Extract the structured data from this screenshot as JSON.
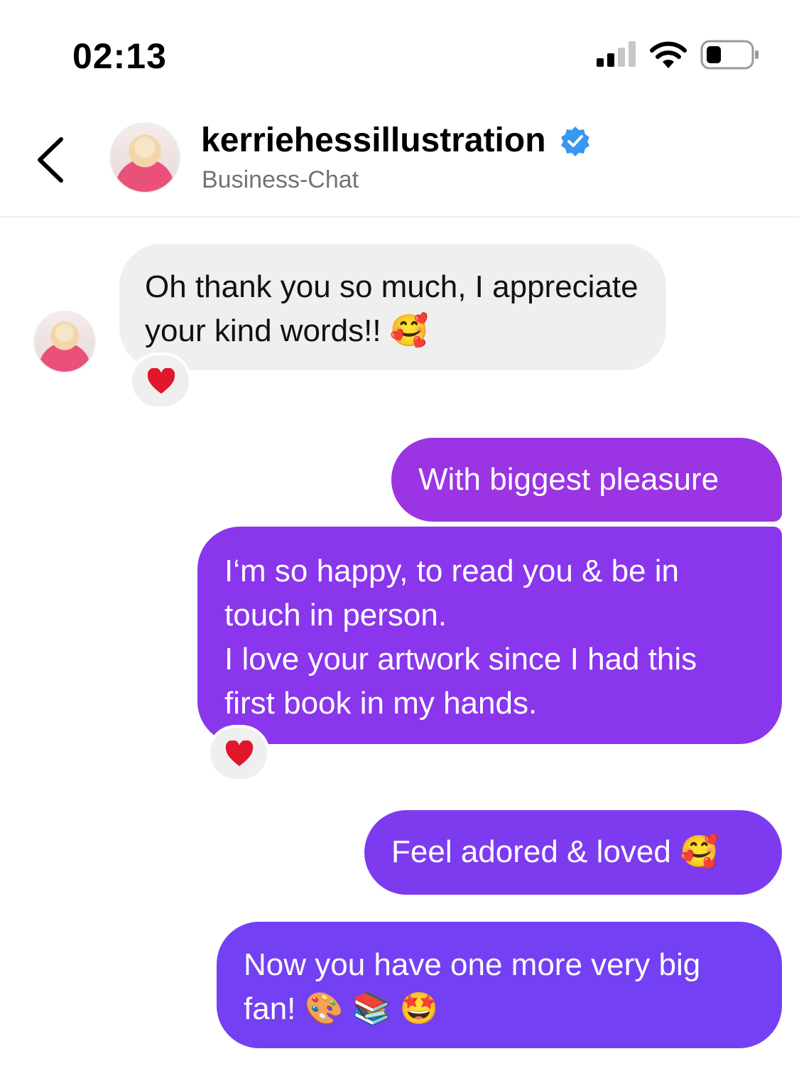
{
  "status_bar": {
    "time": "02:13"
  },
  "header": {
    "username": "kerriehessillustration",
    "subtitle": "Business-Chat"
  },
  "messages": [
    {
      "sender": "them",
      "text": "Oh thank you so much, I appreciate your kind words!! 🥰",
      "reaction": "❤️"
    },
    {
      "sender": "me",
      "text": "With biggest pleasure"
    },
    {
      "sender": "me",
      "text_line1": "I‘m so happy, to read you & be in touch in person.",
      "text_line2": "I love your artwork since I had this first book in my hands.",
      "reaction": "❤️"
    },
    {
      "sender": "me",
      "text": "Feel adored & loved 🥰"
    },
    {
      "sender": "me",
      "text": "Now you have one more very big fan! 🎨 📚 🤩"
    }
  ],
  "colors": {
    "incoming_bubble": "#efefef",
    "outgoing_1": "#9b34e2",
    "outgoing_2": "#8a36ec",
    "outgoing_3": "#7d3bf0",
    "outgoing_4": "#7340f3",
    "verified_badge": "#3897f0"
  },
  "icons": [
    "signal-icon",
    "wifi-icon",
    "battery-icon",
    "back-chevron-icon",
    "verified-badge-icon",
    "heart-reaction-icon"
  ]
}
